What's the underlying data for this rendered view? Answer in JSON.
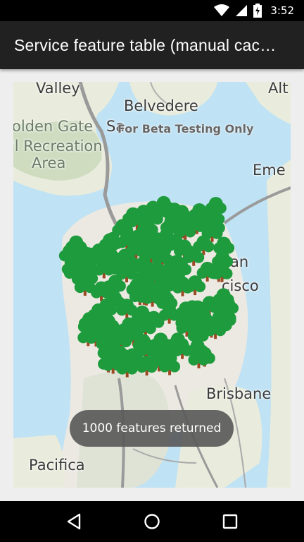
{
  "status_bar": {
    "time": "3:52"
  },
  "app_bar": {
    "title": "Service feature table (manual cac…"
  },
  "map": {
    "watermark": "For Beta Testing Only",
    "labels": {
      "valley": "Valley",
      "alt": "Alt",
      "belvedere": "Belvedere",
      "golden_gate": "olden Gate",
      "san_prefix": "Sa",
      "recreation": "'l Recreation",
      "area": "Area",
      "eme": "Eme",
      "san": "an",
      "cisco": "cisco",
      "brisbane": "Brisbane",
      "pacifica": "Pacifica"
    },
    "features": {
      "count": 1000,
      "marker": "tree-icon"
    }
  },
  "toast": {
    "message": "1000 features returned"
  },
  "nav_bar": {
    "back": "back-icon",
    "home": "home-icon",
    "recents": "recents-icon"
  }
}
